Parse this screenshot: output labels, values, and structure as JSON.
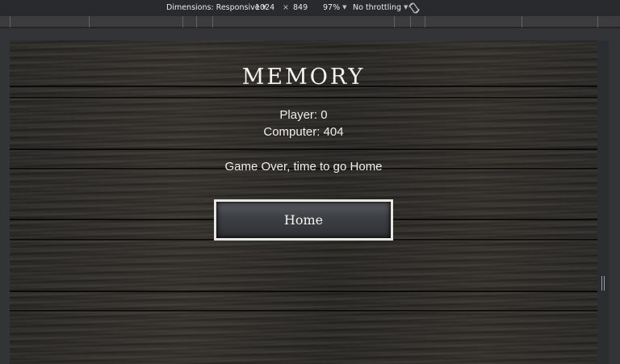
{
  "devtools": {
    "dimensions_label": "Dimensions: Responsive",
    "width": "1024",
    "times": "×",
    "height": "849",
    "zoom": "97%",
    "throttling": "No throttling"
  },
  "game": {
    "title": "MEMORY",
    "player_score": "Player: 0",
    "computer_score": "Computer: 404",
    "message": "Game Over, time to go Home",
    "home_button": "Home"
  }
}
